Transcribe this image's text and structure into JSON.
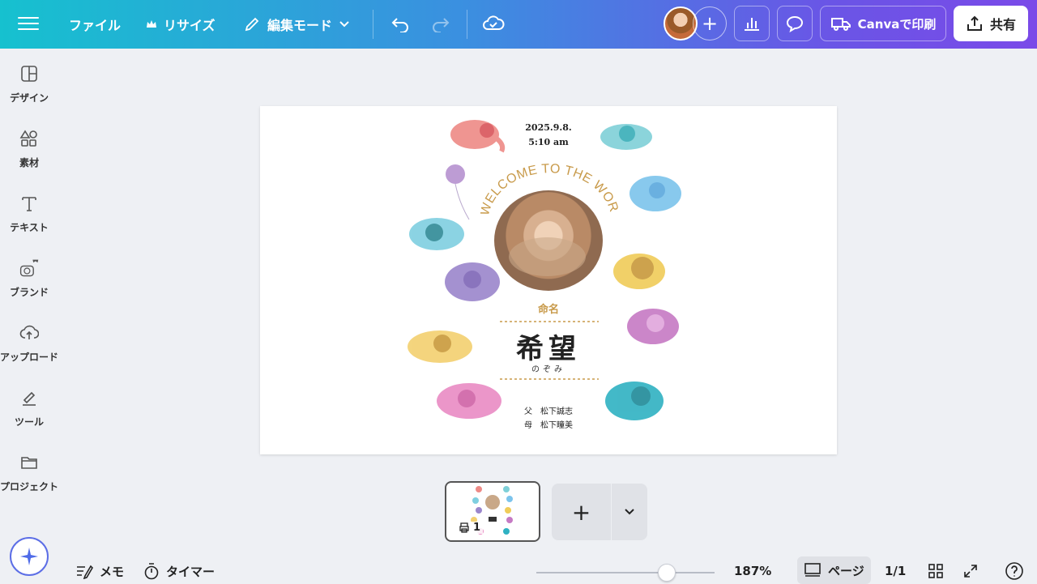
{
  "topbar": {
    "file": "ファイル",
    "resize": "リサイズ",
    "edit_mode": "編集モード",
    "print": "Canvaで印刷",
    "share": "共有"
  },
  "sidebar": {
    "items": [
      {
        "label": "デザイン",
        "icon": "design-icon"
      },
      {
        "label": "素材",
        "icon": "elements-icon"
      },
      {
        "label": "テキスト",
        "icon": "text-icon"
      },
      {
        "label": "ブランド",
        "icon": "brand-icon"
      },
      {
        "label": "アップロード",
        "icon": "upload-icon"
      },
      {
        "label": "ツール",
        "icon": "tools-icon"
      },
      {
        "label": "プロジェクト",
        "icon": "projects-icon"
      }
    ]
  },
  "design": {
    "date": "2025.9.8.",
    "time": "5:10 am",
    "welcome": "WELCOME TO THE WORLD!",
    "naming": "命名",
    "name": "希望",
    "name_reading": "のぞみ",
    "father": "父　松下誠志",
    "mother": "母　松下瞳美"
  },
  "pages": {
    "thumb_number": "1"
  },
  "bottom": {
    "notes": "メモ",
    "timer": "タイマー",
    "zoom": "187%",
    "zoom_level": 0.73,
    "page_view": "ページ",
    "page_count": "1/1"
  },
  "colors": {
    "accent": "#7a4ae8",
    "gold": "#c89a4a"
  }
}
